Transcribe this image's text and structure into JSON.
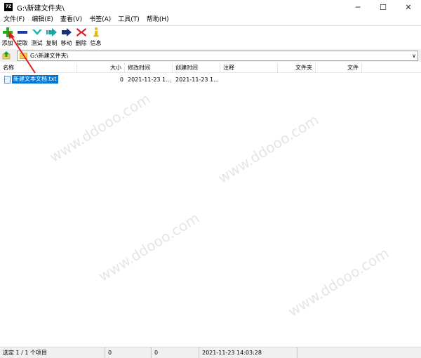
{
  "window": {
    "app_icon_text": "7Z",
    "title": "G:\\新建文件夹\\",
    "minimize": "─",
    "maximize": "☐",
    "close": "✕"
  },
  "menu": [
    "文件(F)",
    "编辑(E)",
    "查看(V)",
    "书签(A)",
    "工具(T)",
    "帮助(H)"
  ],
  "toolbar": {
    "add": "添加",
    "extract": "提取",
    "test": "测试",
    "copy": "复制",
    "move": "移动",
    "delete": "删除",
    "info": "信息"
  },
  "address": {
    "path": "G:\\新建文件夹\\",
    "dropdown": "∨"
  },
  "columns": [
    "名称",
    "大小",
    "修改时间",
    "创建时间",
    "注释",
    "文件夹",
    "文件"
  ],
  "files": [
    {
      "name": "新建文本文档.txt",
      "size": "0",
      "modified": "2021-11-23 1...",
      "created": "2021-11-23 1..."
    }
  ],
  "status": {
    "selected": "选定 1 / 1 个项目",
    "size1": "0",
    "size2": "0",
    "time": "2021-11-23 14:03:28"
  },
  "colors": {
    "selection": "#0078d7",
    "add_icon": "#19b419",
    "extract_icon": "#1c3aa8",
    "delete_icon": "#d81919",
    "arrow": "#e41b1b"
  }
}
